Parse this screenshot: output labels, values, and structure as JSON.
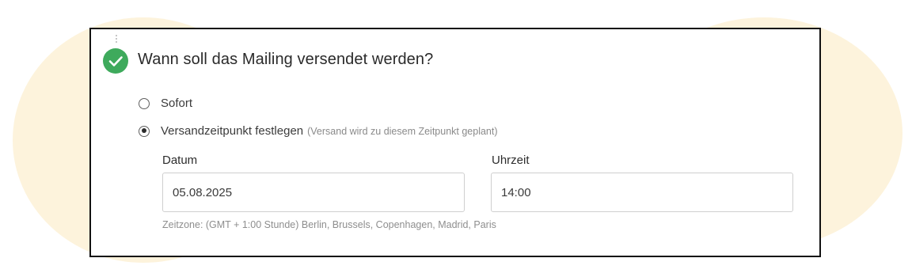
{
  "section": {
    "title": "Wann soll das Mailing versendet werden?",
    "status_icon": "check-circle-icon",
    "status_color": "#3eaa5c"
  },
  "options": [
    {
      "label": "Sofort",
      "hint": "",
      "selected": false
    },
    {
      "label": "Versandzeitpunkt festlegen",
      "hint": "(Versand wird zu diesem Zeitpunkt geplant)",
      "selected": true
    }
  ],
  "date_field": {
    "label": "Datum",
    "value": "05.08.2025"
  },
  "time_field": {
    "label": "Uhrzeit",
    "value": "14:00"
  },
  "timezone_note": "Zeitzone: (GMT + 1:00 Stunde) Berlin, Brussels, Copenhagen, Madrid, Paris",
  "colors": {
    "background_blob": "#fdf3dc",
    "card_border": "#111111",
    "accent_green": "#3eaa5c"
  }
}
